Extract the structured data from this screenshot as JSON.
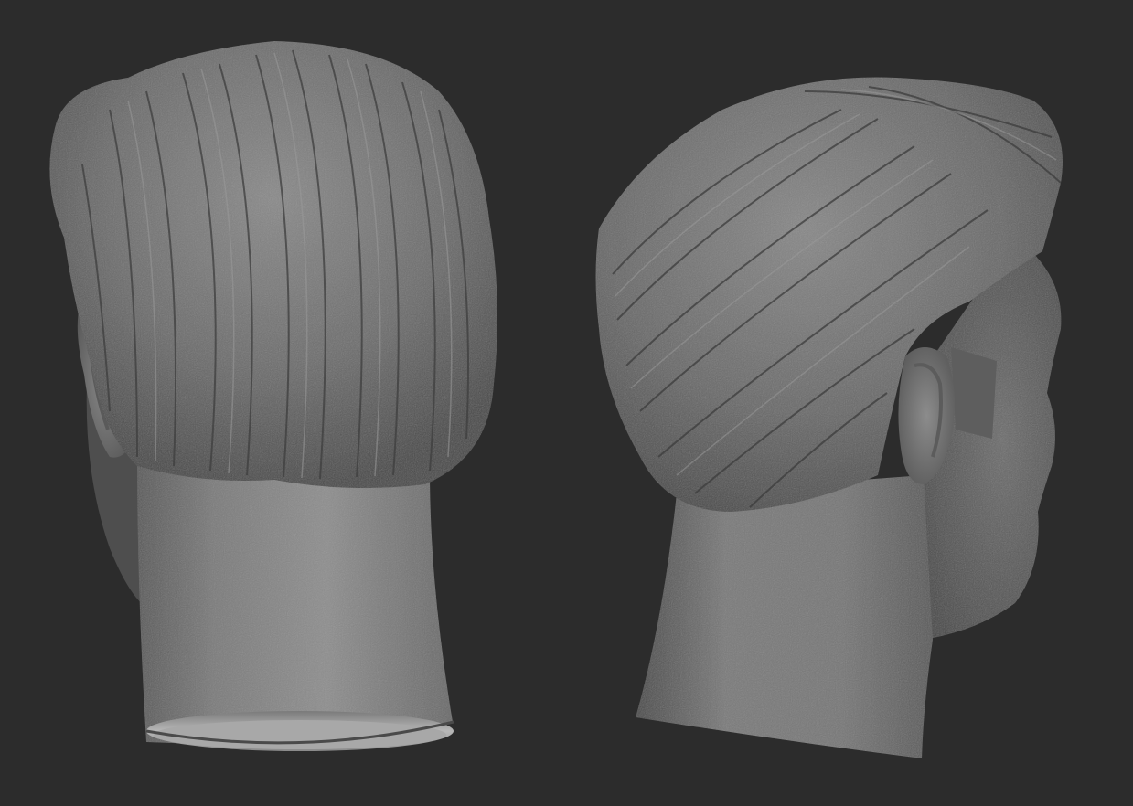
{
  "scene": {
    "background_color": "#2c2c2c",
    "clay_color": "#6e6e6e",
    "clay_highlight": "#9a9a9a",
    "clay_shadow": "#3c3c3c",
    "models": [
      {
        "name": "head-back-view"
      },
      {
        "name": "head-side-view"
      }
    ]
  }
}
